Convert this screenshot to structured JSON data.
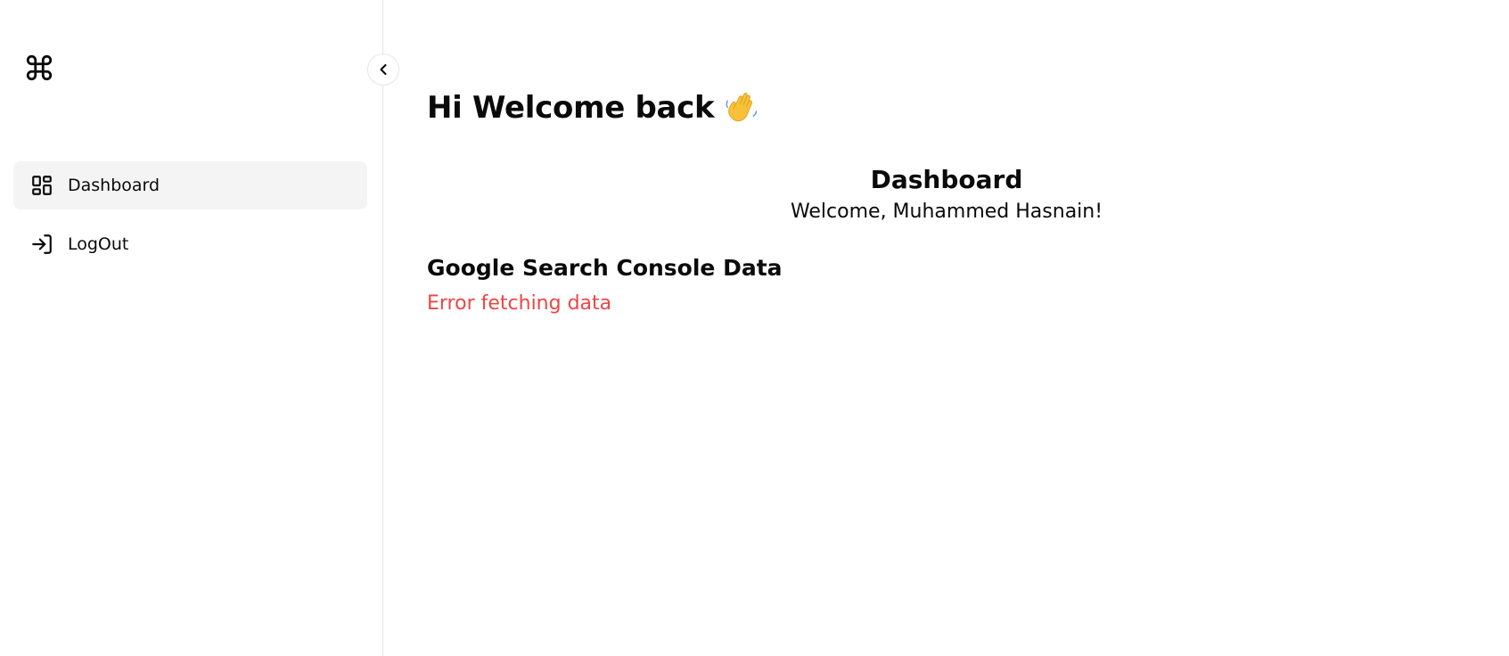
{
  "sidebar": {
    "logo_icon": "command-icon",
    "collapse_icon": "chevron-left-icon",
    "items": [
      {
        "label": "Dashboard",
        "icon": "dashboard-grid-icon",
        "active": true
      },
      {
        "label": "LogOut",
        "icon": "log-in-arrow-icon",
        "active": false
      }
    ]
  },
  "main": {
    "greeting": "Hi Welcome back",
    "greeting_emoji": "waving-hand-icon",
    "dashboard": {
      "title": "Dashboard",
      "welcome": "Welcome, Muhammed Hasnain!"
    },
    "search_console": {
      "title": "Google Search Console Data",
      "error": "Error fetching data"
    }
  },
  "colors": {
    "error": "#ef4444",
    "active_nav_bg": "#f4f4f5",
    "border": "#e5e5e5"
  }
}
